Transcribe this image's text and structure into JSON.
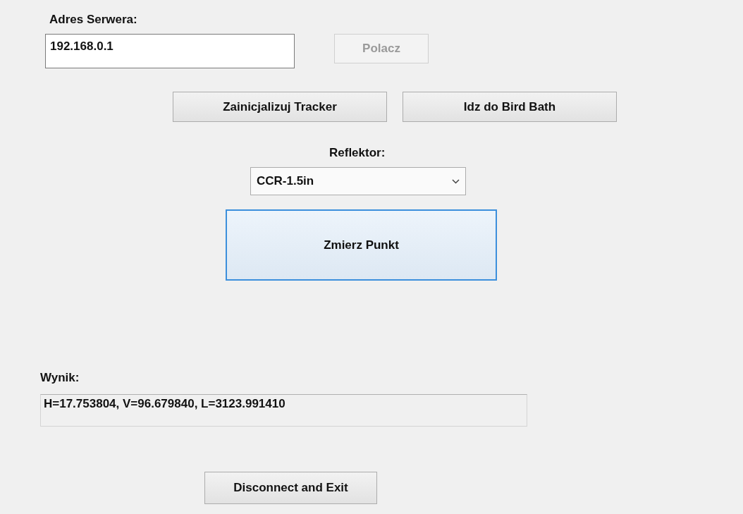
{
  "server": {
    "label": "Adres Serwera:",
    "value": "192.168.0.1"
  },
  "connect_button": {
    "label": "Polacz",
    "disabled": true
  },
  "tracker_buttons": [
    {
      "label": "Zainicjalizuj Tracker"
    },
    {
      "label": "Idz do Bird Bath"
    }
  ],
  "reflector": {
    "label": "Reflektor:",
    "value": "CCR-1.5in"
  },
  "measure_button": {
    "label": "Zmierz Punkt",
    "focused": true
  },
  "result": {
    "label": "Wynik:",
    "value": "H=17.753804, V=96.679840, L=3123.991410"
  },
  "exit_button": {
    "label": "Disconnect and Exit"
  }
}
